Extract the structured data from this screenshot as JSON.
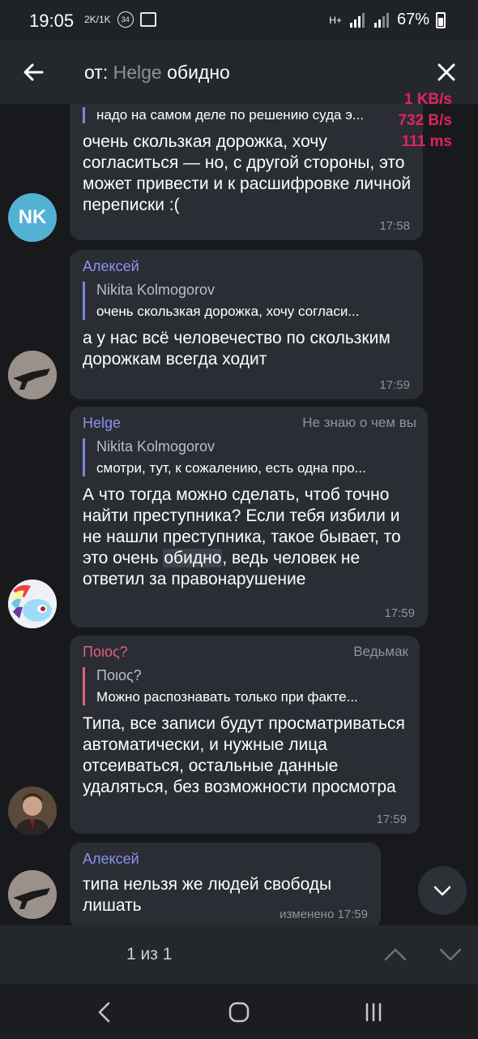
{
  "status": {
    "time": "19:05",
    "icons": [
      "2K/1K",
      "34",
      "image-icon"
    ],
    "network": "H+",
    "battery": "67%"
  },
  "search": {
    "prefix": "от:",
    "user": "Helge",
    "query": "обидно"
  },
  "messages": [
    {
      "reply_text": "надо на самом деле по решению суда э...",
      "text": "очень скользкая дорожка, хочу согласиться — но, с другой стороны, это может привести и к расшифровке личной переписки :(",
      "time": "17:58",
      "avatar_initials": "NK"
    },
    {
      "name": "Алексей",
      "reply_name": "Nikita Kolmogorov",
      "reply_text": "очень скользкая дорожка, хочу согласи...",
      "text": "а у нас всё человечество по скользким дорожкам всегда ходит",
      "time": "17:59"
    },
    {
      "name": "Helge",
      "rank": "Не знаю о чем вы",
      "reply_name": "Nikita Kolmogorov",
      "reply_text": "смотри, тут, к сожалению, есть одна про...",
      "text_before": "А что тогда можно сделать, чтоб точно найти преступника? Если тебя избили и не нашли преступника, такое бывает, то это очень ",
      "text_highlight": "обидно",
      "text_after": ", ведь человек не ответил за правонарушение",
      "time": "17:59"
    },
    {
      "name": "Поιος?",
      "rank": "Ведьмак",
      "reply_name": "Поιος?",
      "reply_text": "Можно распознавать только при факте...",
      "text": "Типа, все записи будут просматриваться автоматически, и нужные лица отсеиваться, остальные данные удаляться, без возможности просмотра",
      "time": "17:59"
    },
    {
      "name": "Алексей",
      "text": "типа нельзя же людей свободы лишать",
      "time": "изменено 17:59"
    }
  ],
  "netstats": {
    "down": "1 KB/s",
    "up": "732 B/s",
    "ping": "111 ms"
  },
  "colors": {
    "name_aleksey": "#8a93f0",
    "name_helge": "#8a93f0",
    "name_poios": "#e0607e",
    "reply_bar": "#7c87d6",
    "netstats": "#e0245e"
  },
  "search_nav": {
    "count": "1 из 1"
  }
}
